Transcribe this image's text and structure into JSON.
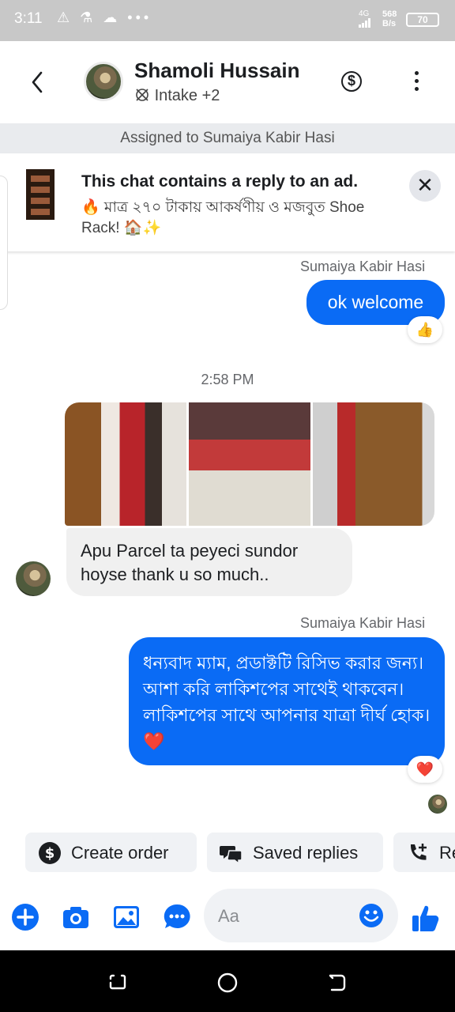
{
  "status_bar": {
    "time": "3:11",
    "icons": "⚠ ⚗ ☁ •••",
    "network": "4G",
    "speed_value": "568",
    "speed_unit": "B/s",
    "battery": "70"
  },
  "header": {
    "name": "Shamoli Hussain",
    "subtitle": "Intake +2",
    "icons": [
      "back-arrow-icon",
      "dollar-icon",
      "more-vertical-icon"
    ]
  },
  "assigned_banner": "Assigned to Sumaiya Kabir Hasi",
  "ad_notice": {
    "title": "This chat contains a reply to an ad.",
    "text": "🔥 মাত্র ২৭০ টাকায় আকর্ষণীয় ও মজবুত  Shoe Rack! 🏠✨",
    "close": "✕"
  },
  "messages": [
    {
      "type": "outgoing",
      "sender": "Sumaiya Kabir Hasi",
      "text": "ok welcome",
      "reaction": "👍"
    },
    {
      "type": "timestamp",
      "text": "2:58 PM"
    },
    {
      "type": "incoming-images",
      "count": 3
    },
    {
      "type": "incoming",
      "text": "Apu Parcel  ta peyeci sundor hoyse thank u so much.."
    },
    {
      "type": "outgoing",
      "sender": "Sumaiya Kabir Hasi",
      "text": "ধন্যবাদ ম্যাম, প্রডাক্টটি রিসিভ করার জন্য। আশা করি লাকিশপের সাথেই থাকবেন। লাকিশপের সাথে আপনার যাত্রা দীর্ঘ হোক। ❤️",
      "reaction": "❤️"
    }
  ],
  "quick_actions": [
    {
      "label": "Create order",
      "icon": "dollar-icon"
    },
    {
      "label": "Saved replies",
      "icon": "chat-bubbles-icon"
    },
    {
      "label": "Re",
      "icon": "phone-plus-icon"
    }
  ],
  "composer": {
    "placeholder": "Aa",
    "icons": [
      "plus-icon",
      "camera-icon",
      "gallery-icon",
      "chat-dots-icon",
      "emoji-icon",
      "thumbs-up-icon"
    ]
  },
  "colors": {
    "accent": "#0a6bf5",
    "bubble_in": "#f0f0f0",
    "status_bar": "#c8c8c8",
    "nav_bar": "#000000"
  }
}
